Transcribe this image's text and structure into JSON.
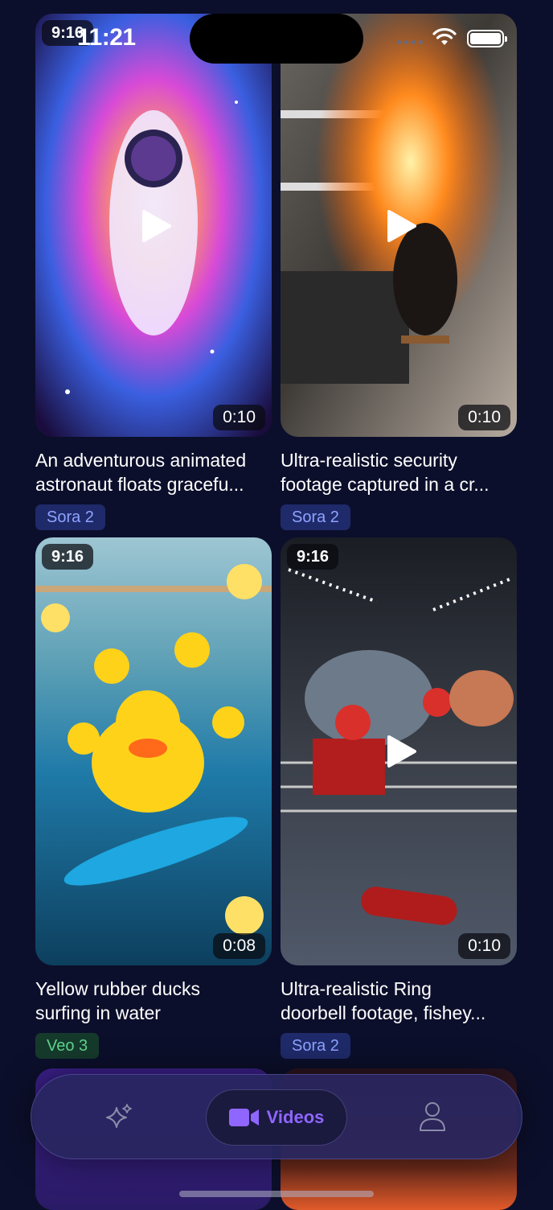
{
  "status_bar": {
    "time": "11:21"
  },
  "cards": [
    {
      "time_label": "9:16",
      "duration": "0:10",
      "caption_line1": "An adventurous animated",
      "caption_line2": "astronaut floats gracefu...",
      "model": "Sora 2",
      "model_style": "sora",
      "colors": {
        "accent": "#c36bff"
      }
    },
    {
      "time_label": "9:16",
      "duration": "0:10",
      "caption_line1": "Ultra-realistic security",
      "caption_line2": "footage captured in a cr...",
      "model": "Sora 2",
      "model_style": "sora",
      "colors": {
        "accent": "#ff7a1a"
      }
    },
    {
      "time_label": "9:16",
      "duration": "0:08",
      "caption_line1": "Yellow rubber ducks",
      "caption_line2": "surfing in water",
      "model": "Veo 3",
      "model_style": "veo",
      "colors": {
        "accent": "#ffd21a"
      }
    },
    {
      "time_label": "9:16",
      "duration": "0:10",
      "caption_line1": "Ultra-realistic Ring",
      "caption_line2": "doorbell footage, fishey...",
      "model": "Sora 2",
      "model_style": "sora",
      "colors": {
        "accent": "#d9302c"
      }
    }
  ],
  "tab_bar": {
    "items": [
      {
        "id": "create",
        "icon": "sparkles-icon",
        "label": ""
      },
      {
        "id": "videos",
        "icon": "video-camera-icon",
        "label": "Videos",
        "active": true
      },
      {
        "id": "profile",
        "icon": "person-icon",
        "label": ""
      }
    ],
    "active_color": "#8f66ff"
  }
}
